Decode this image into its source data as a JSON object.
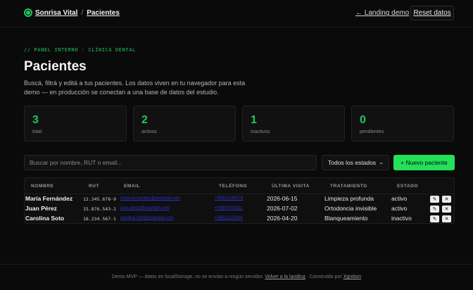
{
  "header": {
    "brand": "Sonrisa Vital",
    "separator": "/",
    "section": "Pacientes",
    "landing_link": "← Landing demo",
    "reset_button": "Reset datos"
  },
  "hero": {
    "kicker": "// PANEL INTERNO · CLÍNICA DENTAL",
    "title": "Pacientes",
    "subtitle": "Buscá, filtrá y editá a tus pacientes. Los datos viven en tu navegador para esta demo — en producción se conectan a una base de datos del estudio."
  },
  "stats": [
    {
      "value": "3",
      "label": "total"
    },
    {
      "value": "2",
      "label": "activos"
    },
    {
      "value": "1",
      "label": "inactivos"
    },
    {
      "value": "0",
      "label": "pendientes"
    }
  ],
  "controls": {
    "search_placeholder": "Buscar por nombre, RUT o email...",
    "status_filter": "Todos los estados",
    "new_patient_button": "+ Nuevo paciente"
  },
  "table": {
    "columns": [
      "NOMBRE",
      "RUT",
      "EMAIL",
      "TELÉFONO",
      "ÚLTIMA VISITA",
      "TRATAMIENTO",
      "ESTADO"
    ],
    "rows": [
      {
        "name": "María Fernández",
        "rut": "12.345.678-9",
        "email": "maria.fernandez@example.com",
        "phone": "+56912345678",
        "last_visit": "2026-06-15",
        "treatment": "Limpieza profunda",
        "status": "activo"
      },
      {
        "name": "Juan Pérez",
        "rut": "15.876.543-2",
        "email": "juan.perez@example.com",
        "phone": "+56987654321",
        "last_visit": "2026-07-02",
        "treatment": "Ortodoncia invisible",
        "status": "activo"
      },
      {
        "name": "Carolina Soto",
        "rut": "18.234.567-1",
        "email": "carolina.soto@example.com",
        "phone": "+56911223344",
        "last_visit": "2026-04-20",
        "treatment": "Blanqueamiento",
        "status": "inactivo"
      }
    ],
    "edit_icon": "✎",
    "delete_icon": "✕"
  },
  "footer": {
    "text_before": "Demo MVP — datos en localStorage, no se envían a ningún servidor. ",
    "landing_link": "Volver a la landing",
    "text_middle": " · Construido por ",
    "credit_link": "Xgnition"
  },
  "colors": {
    "accent": "#22c55e",
    "background": "#0a0a0a",
    "link": "#2d32c9"
  }
}
